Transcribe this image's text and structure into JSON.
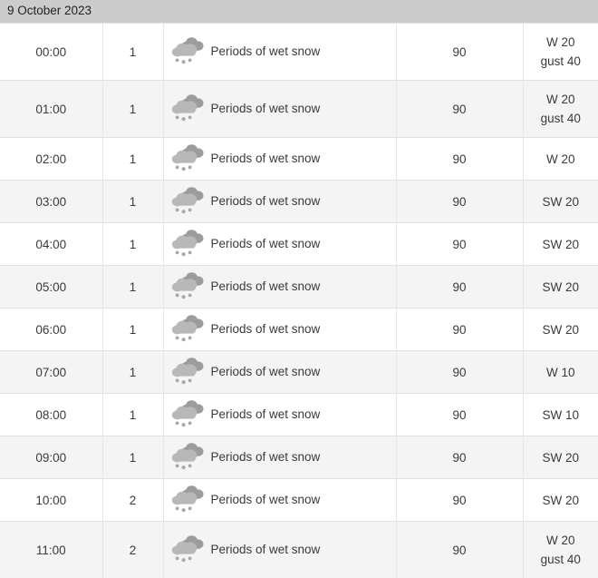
{
  "header": {
    "date_label": "9 October 2023"
  },
  "icon": {
    "name": "wet-snow-icon",
    "cloud_back_color": "#9c9c9c",
    "cloud_front_color": "#b8b8b8",
    "flake_color": "#a8a8a8"
  },
  "colors": {
    "header_background": "#cccccc",
    "row_even_background": "#ffffff",
    "row_odd_background": "#f4f4f4",
    "border": "#e0e0e0",
    "text": "#3a3a3a"
  },
  "table": {
    "rows": [
      {
        "time": "00:00",
        "amount": "1",
        "icon": "wet-snow-icon",
        "description": "Periods of wet snow",
        "probability": "90",
        "wind": "W 20",
        "gust": "gust 40"
      },
      {
        "time": "01:00",
        "amount": "1",
        "icon": "wet-snow-icon",
        "description": "Periods of wet snow",
        "probability": "90",
        "wind": "W 20",
        "gust": "gust 40"
      },
      {
        "time": "02:00",
        "amount": "1",
        "icon": "wet-snow-icon",
        "description": "Periods of wet snow",
        "probability": "90",
        "wind": "W 20",
        "gust": ""
      },
      {
        "time": "03:00",
        "amount": "1",
        "icon": "wet-snow-icon",
        "description": "Periods of wet snow",
        "probability": "90",
        "wind": "SW 20",
        "gust": ""
      },
      {
        "time": "04:00",
        "amount": "1",
        "icon": "wet-snow-icon",
        "description": "Periods of wet snow",
        "probability": "90",
        "wind": "SW 20",
        "gust": ""
      },
      {
        "time": "05:00",
        "amount": "1",
        "icon": "wet-snow-icon",
        "description": "Periods of wet snow",
        "probability": "90",
        "wind": "SW 20",
        "gust": ""
      },
      {
        "time": "06:00",
        "amount": "1",
        "icon": "wet-snow-icon",
        "description": "Periods of wet snow",
        "probability": "90",
        "wind": "SW 20",
        "gust": ""
      },
      {
        "time": "07:00",
        "amount": "1",
        "icon": "wet-snow-icon",
        "description": "Periods of wet snow",
        "probability": "90",
        "wind": "W 10",
        "gust": ""
      },
      {
        "time": "08:00",
        "amount": "1",
        "icon": "wet-snow-icon",
        "description": "Periods of wet snow",
        "probability": "90",
        "wind": "SW 10",
        "gust": ""
      },
      {
        "time": "09:00",
        "amount": "1",
        "icon": "wet-snow-icon",
        "description": "Periods of wet snow",
        "probability": "90",
        "wind": "SW 20",
        "gust": ""
      },
      {
        "time": "10:00",
        "amount": "2",
        "icon": "wet-snow-icon",
        "description": "Periods of wet snow",
        "probability": "90",
        "wind": "SW 20",
        "gust": ""
      },
      {
        "time": "11:00",
        "amount": "2",
        "icon": "wet-snow-icon",
        "description": "Periods of wet snow",
        "probability": "90",
        "wind": "W 20",
        "gust": "gust 40"
      }
    ]
  }
}
